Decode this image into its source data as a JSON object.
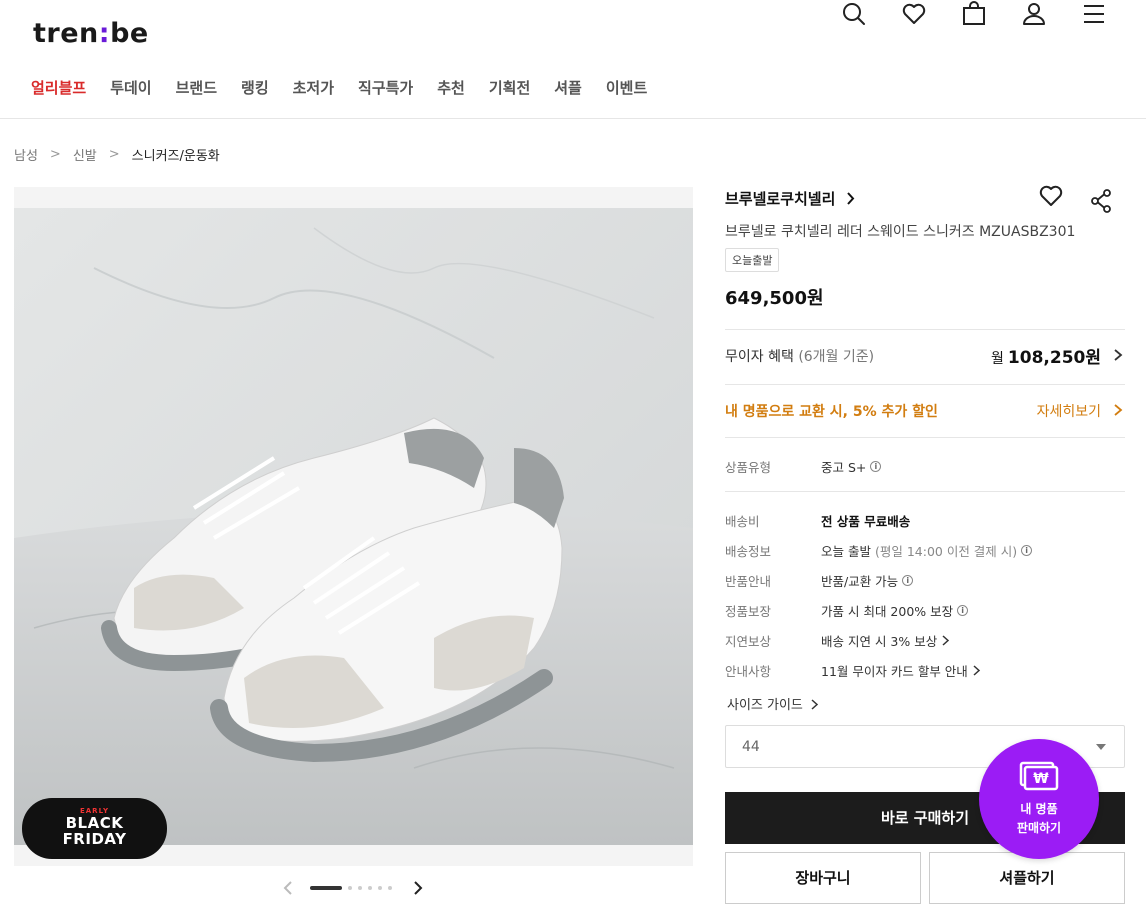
{
  "header": {
    "logo_left": "tren",
    "logo_dot": ":",
    "logo_right": "be",
    "icons": [
      "search-icon",
      "heart-icon",
      "shopping-bag-icon",
      "user-icon",
      "menu-icon"
    ]
  },
  "nav": {
    "items": [
      "얼리블프",
      "투데이",
      "브랜드",
      "랭킹",
      "초저가",
      "직구특가",
      "추천",
      "기획전",
      "셔플",
      "이벤트"
    ],
    "active_color": "#d92b2b"
  },
  "breadcrumb": {
    "items": [
      "남성",
      "신발",
      "스니커즈/운동화"
    ]
  },
  "gallery": {
    "badge_top": "EARLY",
    "badge_line1": "BLACK",
    "badge_line2": "FRIDAY",
    "page_count": 6,
    "current_page": 1
  },
  "product": {
    "brand": "브루넬로쿠치넬리",
    "name": "브루넬로 쿠치넬리 레더 스웨이드 스니커즈 MZUASBZ301",
    "tag": "오늘출발",
    "price": "649,500원"
  },
  "installment": {
    "label": "무이자 혜택",
    "sub": "(6개월 기준)",
    "prefix": "월",
    "amount": "108,250원"
  },
  "exchange": {
    "label": "내 명품으로 교환 시, 5% 추가 할인",
    "link": "자세히보기",
    "color": "#d27d10"
  },
  "details": {
    "product_type_label": "상품유형",
    "product_type_value": "중고 S+",
    "rows": [
      {
        "k": "배송비",
        "v": "전 상품 무료배송"
      },
      {
        "k": "배송정보",
        "v": "오늘 출발",
        "sub": "(평일 14:00 이전 결제 시)"
      },
      {
        "k": "반품안내",
        "v": "반품/교환 가능"
      },
      {
        "k": "정품보장",
        "v": "가품 시 최대 200% 보장"
      },
      {
        "k": "지연보상",
        "v": "배송 지연 시 3% 보상"
      },
      {
        "k": "안내사항",
        "v": "11월 무이자 카드 할부 안내"
      }
    ]
  },
  "size": {
    "guide": "사이즈 가이드",
    "selected": "44"
  },
  "actions": {
    "buy": "바로 구매하기",
    "cart": "장바구니",
    "shuffle": "셔플하기"
  },
  "sell_fab": {
    "line1": "내 명품",
    "line2": "판매하기",
    "color": "#9b1cf5"
  }
}
